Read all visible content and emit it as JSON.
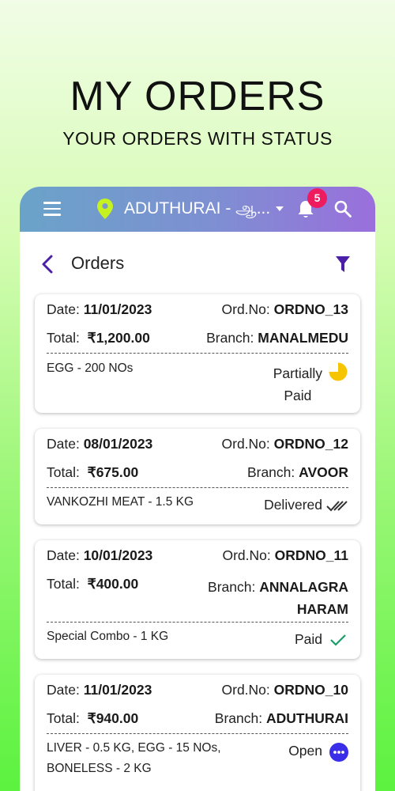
{
  "hero": {
    "title": "MY ORDERS",
    "subtitle": "YOUR ORDERS WITH STATUS"
  },
  "appbar": {
    "location": "ADUTHURAI - ஆ...",
    "notification_count": "5",
    "colors": {
      "start": "#6aa3c9",
      "end": "#9a6fdc",
      "pin": "#c6f21f",
      "badge": "#ee1b5f"
    }
  },
  "header": {
    "title": "Orders"
  },
  "labels": {
    "date": "Date:",
    "ord_no": "Ord.No:",
    "total": "Total:",
    "branch": "Branch:"
  },
  "orders": [
    {
      "date": "11/01/2023",
      "ord_no": "ORDNO_13",
      "total": "₹1,200.00",
      "branch": "MANALMEDU",
      "items": "EGG - 200 NOs",
      "status_line1": "Partially",
      "status_line2": "Paid",
      "status_icon": "partial-pie-icon"
    },
    {
      "date": "08/01/2023",
      "ord_no": "ORDNO_12",
      "total": "₹675.00",
      "branch": "AVOOR",
      "items": "VANKOZHI MEAT - 1.5 KG",
      "status_line1": "Delivered",
      "status_icon": "double-check-icon"
    },
    {
      "date": "10/01/2023",
      "ord_no": "ORDNO_11",
      "total": "₹400.00",
      "branch_line1": "ANNALAGRA",
      "branch_line2": "HARAM",
      "items": "Special Combo - 1 KG",
      "status_line1": "Paid",
      "status_icon": "check-icon"
    },
    {
      "date": "11/01/2023",
      "ord_no": "ORDNO_10",
      "total": "₹940.00",
      "branch": "ADUTHURAI",
      "items_line1": "LIVER - 0.5 KG, EGG - 15 NOs,",
      "items_line2": "BONELESS - 2 KG",
      "status_line1": "Open",
      "status_icon": "more-dots-icon"
    }
  ]
}
